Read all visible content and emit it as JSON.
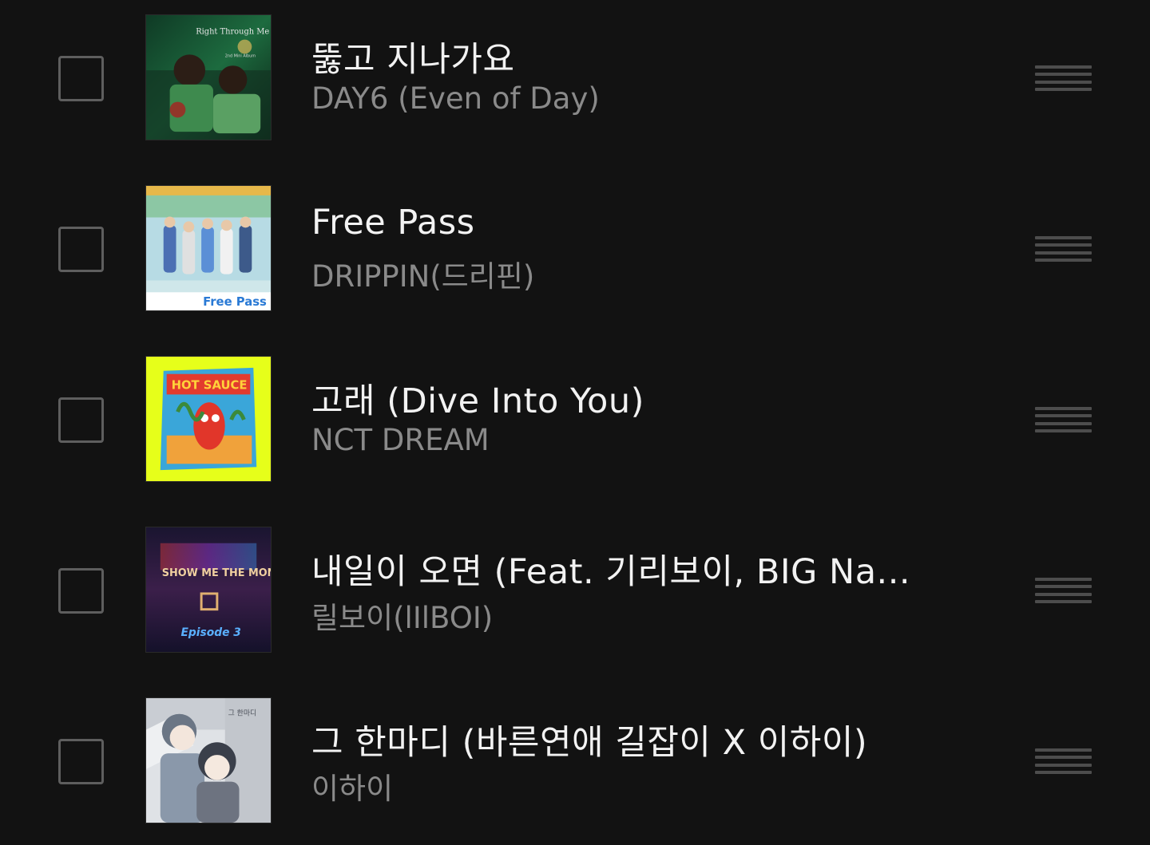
{
  "playlist": {
    "tracks": [
      {
        "title": "뚫고 지나가요",
        "artist": "DAY6 (Even of Day)",
        "art_text": "Right Through Me",
        "art_sub": "2nd Mini Album",
        "art_icon": "album-art-day6"
      },
      {
        "title": "Free Pass",
        "artist": "DRIPPIN(드리핀)",
        "art_text": "Free Pass",
        "art_icon": "album-art-drippin"
      },
      {
        "title": "고래 (Dive Into You)",
        "artist": "NCT DREAM",
        "art_text": "HOT SAUCE",
        "art_icon": "album-art-nct-dream"
      },
      {
        "title": "내일이 오면 (Feat. 기리보이, BIG Na...",
        "artist": "릴보이(lIlBOI)",
        "art_text": "SHOW ME THE MONEY",
        "art_sub": "Episode 3",
        "art_icon": "album-art-smtm"
      },
      {
        "title": "그 한마디 (바른연애 길잡이 X 이하이)",
        "artist": "이하이",
        "art_text": "그 한마디",
        "art_icon": "album-art-webtoon"
      }
    ]
  },
  "colors": {
    "background": "#121212",
    "title": "#f2f2f2",
    "artist": "#8a8a8a",
    "control": "#5e5e5e"
  }
}
